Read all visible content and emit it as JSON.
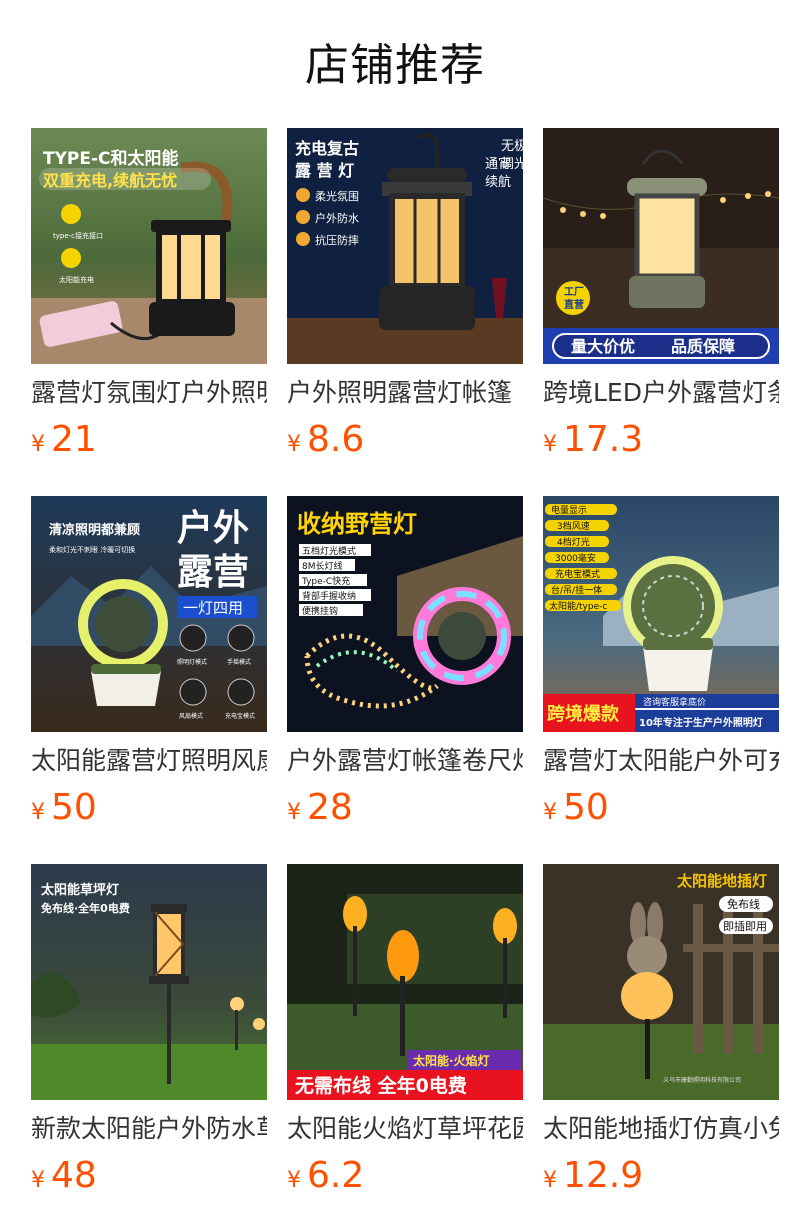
{
  "section_title": "店铺推荐",
  "currency_symbol": "¥",
  "accent_price_color": "#ff5000",
  "products": [
    {
      "title": "露营灯氛围灯户外照明",
      "price": "21",
      "image_icon": "lantern-image",
      "image_texts": [
        "TYPE-C和太阳能",
        "双重充电,续航无忧",
        "type-c接充接口",
        "太阳能充电"
      ]
    },
    {
      "title": "户外照明露营灯帐篷",
      "price": "8.6",
      "image_icon": "lantern-image",
      "image_texts": [
        "充电复古",
        "露 营 灯",
        "无极",
        "调光",
        "通宵",
        "续航",
        "柔光氛围",
        "户外防水",
        "抗压防摔"
      ]
    },
    {
      "title": "跨境LED户外露营灯条",
      "price": "17.3",
      "image_icon": "lantern-image",
      "image_texts": [
        "工厂",
        "直营",
        "量大价优",
        "品质保障"
      ]
    },
    {
      "title": "太阳能露营灯照明风扇",
      "price": "50",
      "image_icon": "fan-lamp-image",
      "image_texts": [
        "清凉照明都兼顾",
        "柔和灯光不刺眼 冷暖可切换",
        "户外",
        "露营",
        "一灯四用",
        "照明灯模式",
        "手摇模式",
        "风扇模式",
        "充电宝模式"
      ]
    },
    {
      "title": "户外露营灯帐篷卷尺灯",
      "price": "28",
      "image_icon": "string-light-image",
      "image_texts": [
        "收纳野营灯",
        "五档灯光模式",
        "8M长灯线",
        "Type-C快充",
        "背部手握收纳",
        "便携挂钩"
      ]
    },
    {
      "title": "露营灯太阳能户外可充电",
      "price": "50",
      "image_icon": "fan-lamp-image",
      "image_texts": [
        "电量显示",
        "3档风速",
        "4档灯光",
        "3000毫安",
        "充电宝模式",
        "台/吊/挂一体",
        "太阳能/type-c",
        "跨境爆款",
        "咨询客服拿底价",
        "10年专注于生产户外照明灯"
      ]
    },
    {
      "title": "新款太阳能户外防水草坪灯",
      "price": "48",
      "image_icon": "garden-light-image",
      "image_texts": [
        "太阳能草坪灯",
        "免布线·全年0电费"
      ]
    },
    {
      "title": "太阳能火焰灯草坪花园",
      "price": "6.2",
      "image_icon": "flame-light-image",
      "image_texts": [
        "太阳能·火焰灯",
        "无需布线 全年0电费"
      ]
    },
    {
      "title": "太阳能地插灯仿真小兔子",
      "price": "12.9",
      "image_icon": "rabbit-light-image",
      "image_texts": [
        "太阳能地插灯",
        "免布线",
        "即插即用",
        "义乌市康勤照明科技有限公司"
      ]
    }
  ]
}
